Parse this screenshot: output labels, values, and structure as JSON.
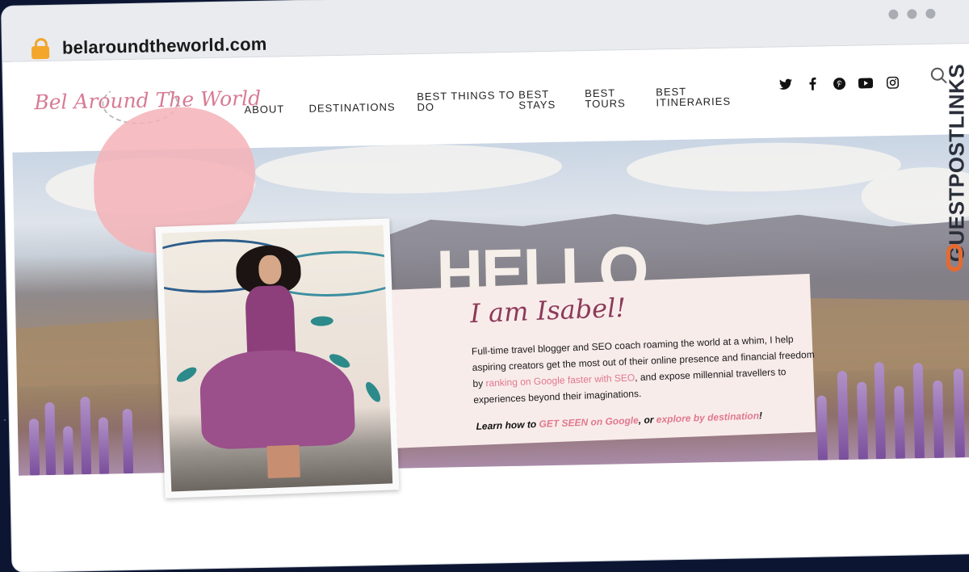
{
  "browser": {
    "url": "belaroundtheworld.com",
    "icons": {
      "lock": "lock-icon",
      "window_controls": [
        "dot-icon",
        "dot-icon",
        "dot-icon"
      ]
    }
  },
  "header": {
    "logo_text": "Bel Around The World",
    "nav": [
      {
        "label": "ABOUT"
      },
      {
        "label": "DESTINATIONS"
      },
      {
        "label": "BEST THINGS TO DO"
      },
      {
        "label": "BEST STAYS"
      },
      {
        "label": "BEST TOURS"
      },
      {
        "label": "BEST ITINERARIES"
      }
    ],
    "social_icons": [
      "twitter-icon",
      "facebook-icon",
      "pinterest-icon",
      "youtube-icon",
      "instagram-icon"
    ],
    "search_icon": "search-icon"
  },
  "hero": {
    "heading": "HELLO",
    "subheading": "I am Isabel!",
    "bio": {
      "text_1": "Full-time travel blogger and SEO coach roaming the world at a whim, I help aspiring creators get the most out of their online presence and financial freedom by ",
      "link": "ranking on Google faster with SEO",
      "text_2": ", and expose millennial travellers to experiences beyond their imaginations."
    },
    "cta": {
      "text_1": "Learn how to ",
      "link_1": "GET SEEN on Google",
      "text_2": ", or ",
      "link_2": "explore by destination",
      "text_3": "!"
    }
  },
  "watermark": {
    "text": "GUESTPOSTLINKS",
    "color": "#e66a2f"
  },
  "colors": {
    "accent_pink": "#e0788f",
    "title_plum": "#8c3a5a",
    "card_bg": "#f8ecea"
  }
}
